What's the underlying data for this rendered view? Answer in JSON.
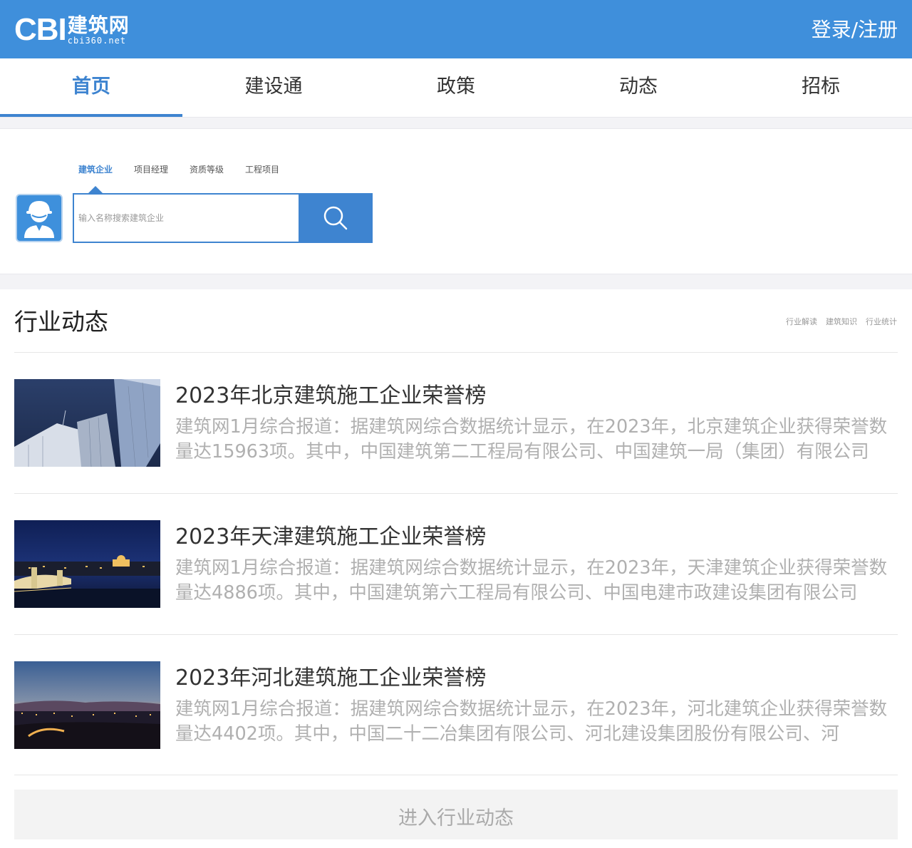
{
  "header": {
    "logo_main": "CBI",
    "logo_cn": "建筑网",
    "logo_url": "cbi360.net",
    "login": "登录/注册",
    "bg_color": "#3f8fdb"
  },
  "nav": {
    "items": [
      "首页",
      "建设通",
      "政策",
      "动态",
      "招标"
    ],
    "active_index": 0
  },
  "search": {
    "tabs": [
      "建筑企业",
      "项目经理",
      "资质等级",
      "工程项目"
    ],
    "active_tab": 0,
    "placeholder": "输入名称搜索建筑企业",
    "icon": "search-icon",
    "avatar_icon": "worker-helmet-icon"
  },
  "news": {
    "title": "行业动态",
    "links": [
      "行业解读",
      "建筑知识",
      "行业统计"
    ],
    "items": [
      {
        "title": "2023年北京建筑施工企业荣誉榜",
        "desc": "建筑网1月综合报道：据建筑网综合数据统计显示，在2023年，北京建筑企业获得荣誉数量达15963项。其中，中国建筑第二工程局有限公司、中国建筑一局（集团）有限公司",
        "image": "skyscrapers-photo"
      },
      {
        "title": "2023年天津建筑施工企业荣誉榜",
        "desc": "建筑网1月综合报道：据建筑网综合数据统计显示，在2023年，天津建筑企业获得荣誉数量达4886项。其中，中国建筑第六工程局有限公司、中国电建市政建设集团有限公司",
        "image": "night-bridge-photo"
      },
      {
        "title": "2023年河北建筑施工企业荣誉榜",
        "desc": "建筑网1月综合报道：据建筑网综合数据统计显示，在2023年，河北建筑企业获得荣誉数量达4402项。其中，中国二十二冶集团有限公司、河北建设集团股份有限公司、河",
        "image": "dusk-city-photo"
      }
    ],
    "more": "进入行业动态"
  }
}
